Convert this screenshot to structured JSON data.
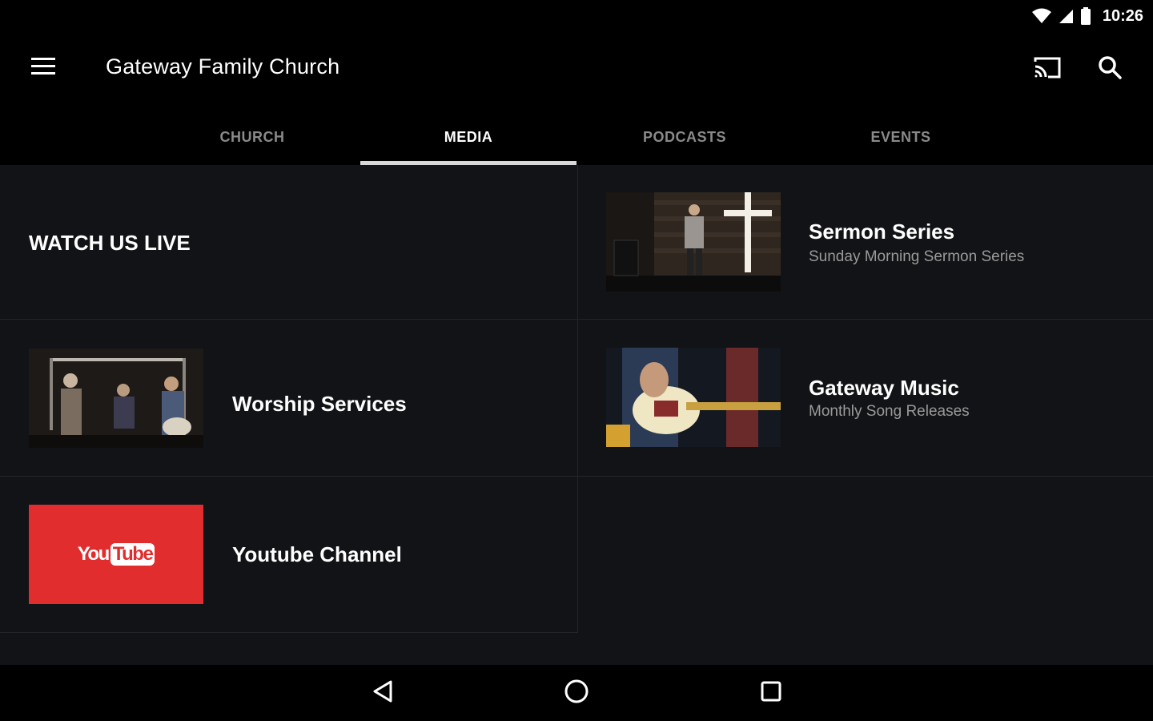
{
  "status_bar": {
    "time": "10:26",
    "icons": [
      "wifi-icon",
      "signal-icon",
      "battery-icon"
    ]
  },
  "toolbar": {
    "title": "Gateway Family Church",
    "icons": [
      "hamburger-menu-icon",
      "cast-icon",
      "search-icon"
    ]
  },
  "tabs": [
    {
      "label": "CHURCH",
      "active": false
    },
    {
      "label": "MEDIA",
      "active": true
    },
    {
      "label": "PODCASTS",
      "active": false
    },
    {
      "label": "EVENTS",
      "active": false
    }
  ],
  "cards": {
    "watch_live": {
      "title": "WATCH US LIVE"
    },
    "sermon_series": {
      "title": "Sermon Series",
      "subtitle": "Sunday Morning Sermon Series"
    },
    "worship_services": {
      "title": "Worship Services"
    },
    "gateway_music": {
      "title": "Gateway Music",
      "subtitle": "Monthly Song Releases"
    },
    "youtube_channel": {
      "title": "Youtube Channel",
      "logo_text_you": "You",
      "logo_text_tube": "Tube"
    }
  },
  "colors": {
    "background": "#000000",
    "content_bg": "#121316",
    "youtube_red": "#e22d2e",
    "tab_inactive": "#8a8a8a",
    "subtitle": "#9a9a9a"
  },
  "nav_bar": {
    "icons": [
      "back-icon",
      "home-icon",
      "recents-icon"
    ]
  }
}
